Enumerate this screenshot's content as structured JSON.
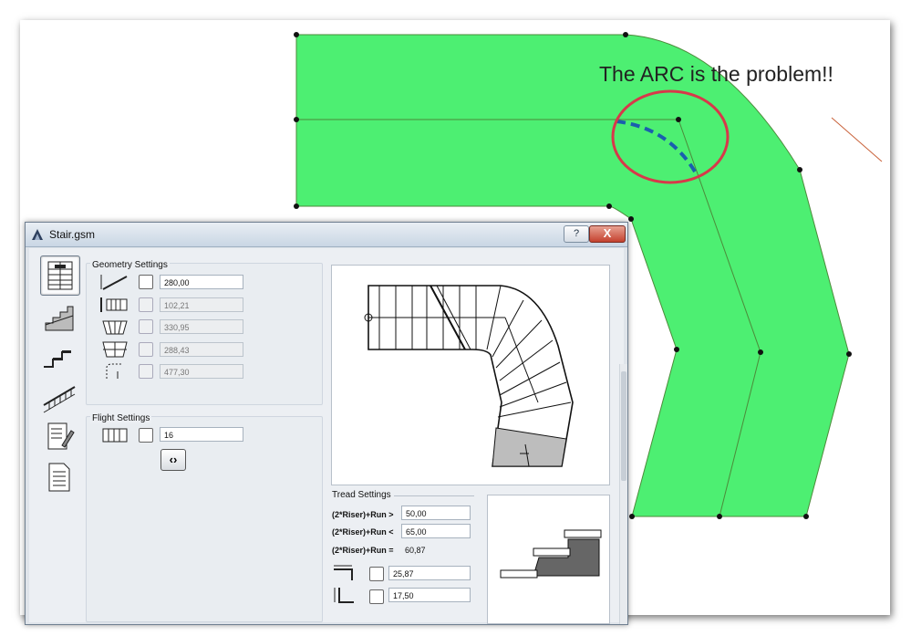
{
  "annotation": "The ARC is the problem!!",
  "dialog": {
    "title": "Stair.gsm",
    "help_label": "?",
    "close_label": "X",
    "geometry": {
      "title": "Geometry Settings",
      "rows": [
        {
          "value": "280,00",
          "enabled": true
        },
        {
          "value": "102,21",
          "enabled": false
        },
        {
          "value": "330,95",
          "enabled": false
        },
        {
          "value": "288,43",
          "enabled": false
        },
        {
          "value": "477,30",
          "enabled": false
        }
      ]
    },
    "flight": {
      "title": "Flight Settings",
      "value": "16",
      "nav_label": "‹›"
    },
    "tread": {
      "title": "Tread Settings",
      "rows": [
        {
          "label": "(2*Riser)+Run >",
          "value": "50,00"
        },
        {
          "label": "(2*Riser)+Run <",
          "value": "65,00"
        },
        {
          "label": "(2*Riser)+Run =",
          "value": "60,87"
        }
      ],
      "tread_depth": "25,87",
      "riser_height": "17,50"
    }
  },
  "colors": {
    "plan_fill": "#4def72",
    "plan_stroke": "#4c8a3a",
    "highlight_circle": "#d8384a",
    "arc_dash": "#1a5fae"
  }
}
